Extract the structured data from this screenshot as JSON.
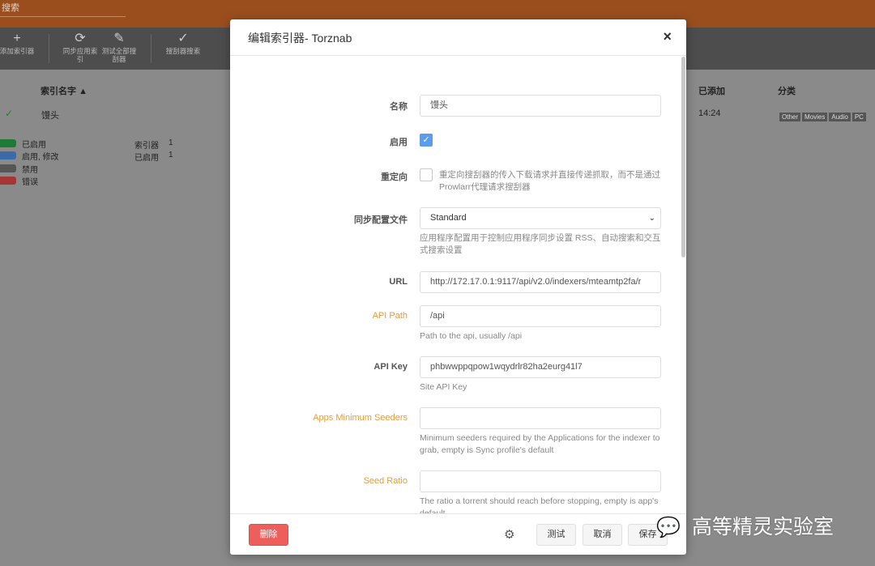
{
  "app": {
    "search_placeholder": "搜索",
    "toolbar": [
      {
        "icon": "plus-icon",
        "glyph": "+",
        "label": "添加索引器"
      },
      {
        "icon": "sync-icon",
        "glyph": "⟳",
        "label": "同步应用索引"
      },
      {
        "icon": "test-icon",
        "glyph": "✎",
        "label": "测试全部搜刮器"
      },
      {
        "icon": "check-icon",
        "glyph": "✓",
        "label": "搜刮器搜索"
      }
    ],
    "list": {
      "col_name": "索引名字",
      "col_added": "已添加",
      "col_categories": "分类",
      "row": {
        "name": "馒头",
        "added": "14:24",
        "tags": [
          "Other",
          "Movies",
          "Audio",
          "PC"
        ]
      }
    },
    "legend": [
      {
        "label": "已启用",
        "color": "#27c24c"
      },
      {
        "label": "启用, 修改",
        "color": "#5d9cec"
      },
      {
        "label": "禁用",
        "color": "#666666"
      },
      {
        "label": "错误",
        "color": "#f05050"
      }
    ],
    "stats": [
      {
        "label": "索引器",
        "value": "1"
      },
      {
        "label": "已启用",
        "value": "1"
      }
    ]
  },
  "modal": {
    "title": "编辑索引器- Torznab",
    "close": "×",
    "fields": {
      "name": {
        "label": "名称",
        "value": "馒头"
      },
      "enable": {
        "label": "启用",
        "checked": true
      },
      "redirect": {
        "label": "重定向",
        "checked": false,
        "help": "重定向搜刮器的传入下载请求并直接传递抓取，而不是通过Prowlarr代理请求搜刮器"
      },
      "sync_profile": {
        "label": "同步配置文件",
        "value": "Standard",
        "help": "应用程序配置用于控制应用程序同步设置 RSS、自动搜索和交互式搜索设置"
      },
      "url": {
        "label": "URL",
        "value": "http://172.17.0.1:9117/api/v2.0/indexers/mteamtp2fa/r"
      },
      "api_path": {
        "label": "API Path",
        "value": "/api",
        "help": "Path to the api, usually /api"
      },
      "api_key": {
        "label": "API Key",
        "value": "phbwwppqpow1wqydrlr82ha2eurg41l7",
        "help": "Site API Key"
      },
      "min_seeders": {
        "label": "Apps Minimum Seeders",
        "value": "",
        "help": "Minimum seeders required by the Applications for the indexer to grab, empty is Sync profile's default"
      },
      "seed_ratio": {
        "label": "Seed Ratio",
        "value": "",
        "help": "The ratio a torrent should reach before stopping, empty is app's default"
      }
    },
    "footer": {
      "delete": "删除",
      "test": "测试",
      "cancel": "取消",
      "save": "保存"
    }
  },
  "watermark": "高等精灵实验室"
}
